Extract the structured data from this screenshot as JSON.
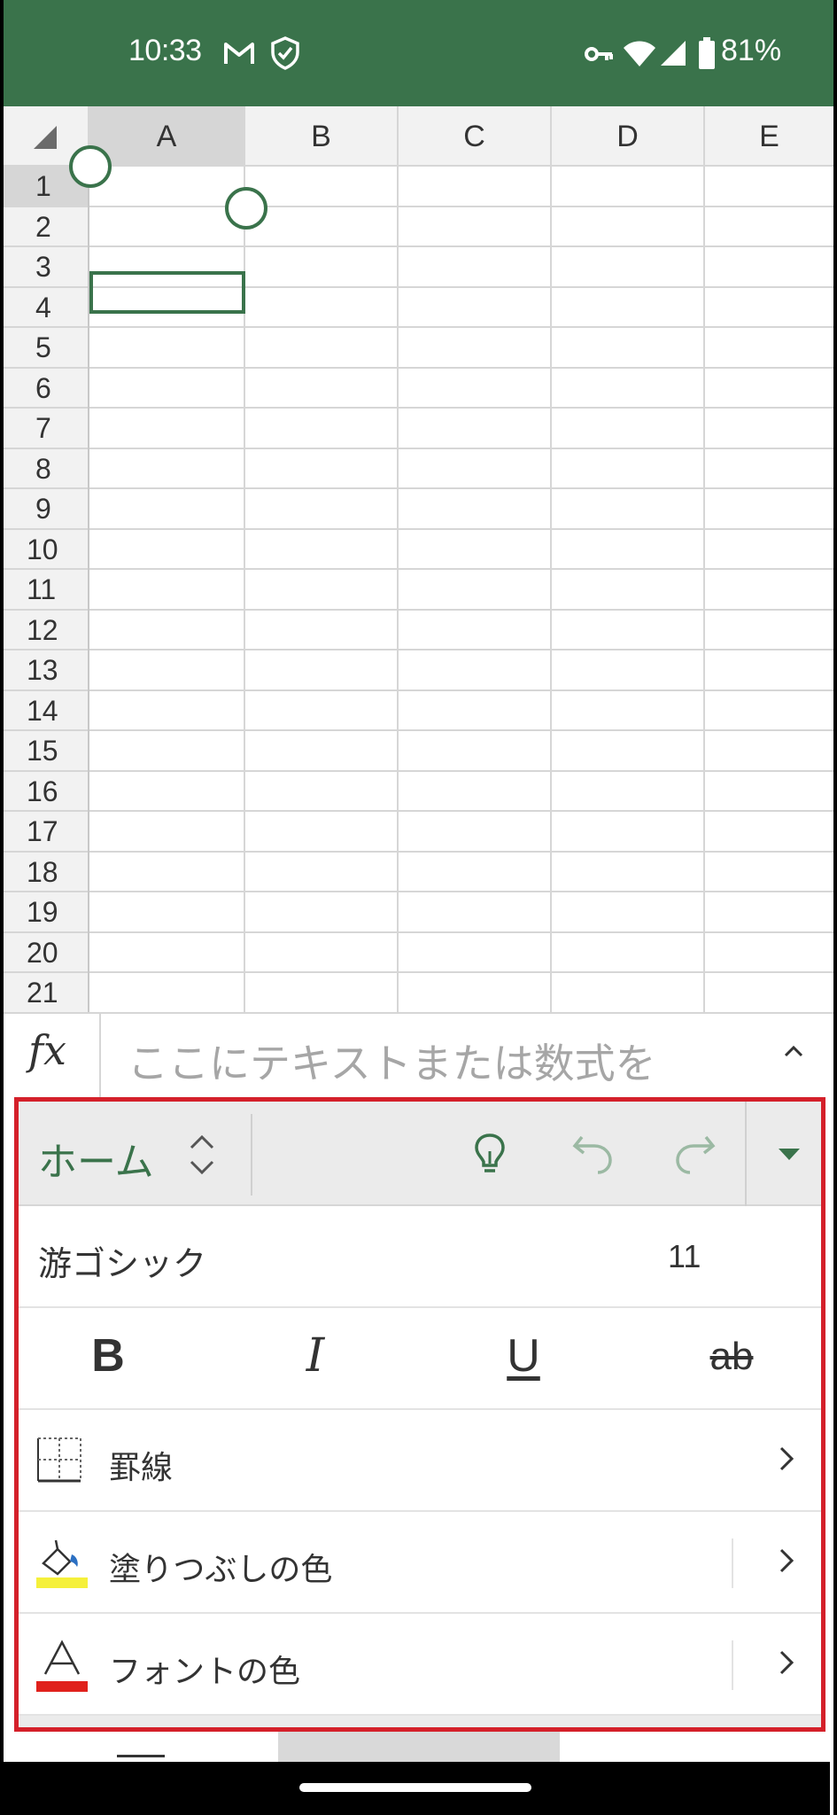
{
  "status_bar": {
    "time": "10:33",
    "battery": "81%",
    "icons": [
      "gmail-icon",
      "shield-icon",
      "vpn-key-icon",
      "wifi-icon",
      "signal-icon",
      "battery-icon"
    ]
  },
  "grid": {
    "columns": [
      "A",
      "B",
      "C",
      "D",
      "E"
    ],
    "rows": [
      "1",
      "2",
      "3",
      "4",
      "5",
      "6",
      "7",
      "8",
      "9",
      "10",
      "11",
      "12",
      "13",
      "14",
      "15",
      "16",
      "17",
      "18",
      "19",
      "20",
      "21"
    ],
    "selected_cell": "A1"
  },
  "formula_bar": {
    "fx_label": "fx",
    "placeholder": "ここにテキストまたは数式を"
  },
  "ribbon": {
    "tab_label": "ホーム",
    "font_name": "游ゴシック",
    "font_size": "11",
    "bold_label": "B",
    "italic_label": "I",
    "underline_label": "U",
    "strikethrough_label": "ab",
    "borders_label": "罫線",
    "fill_color_label": "塗りつぶしの色",
    "font_color_label": "フォントの色",
    "fill_color_swatch": "#f5f03a",
    "font_color_swatch": "#e0211c"
  },
  "colors": {
    "accent": "#3a734b",
    "highlight_border": "#d4202a"
  }
}
